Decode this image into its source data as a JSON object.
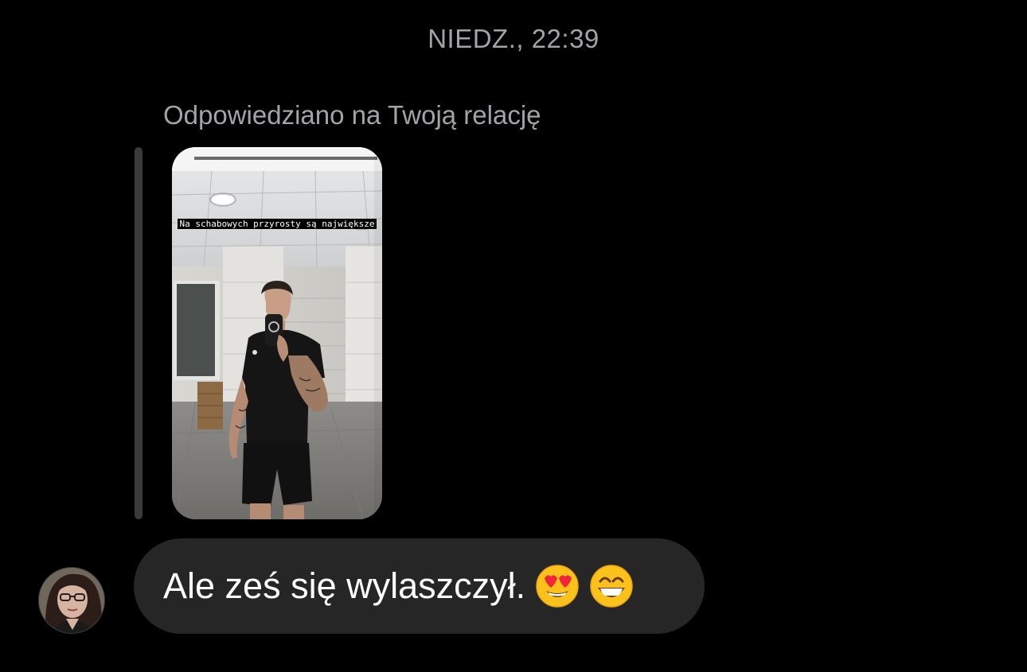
{
  "thread": {
    "timestamp": "NIEDZ., 22:39",
    "reply_caption": "Odpowiedziano na Twoją relację"
  },
  "story": {
    "caption": "Na schabowych przyrosty są największe"
  },
  "message": {
    "text": "Ale ześ się wylaszczył.",
    "emojis": [
      "smiling-face-with-heart-eyes-icon",
      "grinning-face-with-smiling-eyes-icon"
    ]
  },
  "colors": {
    "background": "#000000",
    "bubble": "#262626",
    "secondary_text": "#a3a3a8",
    "reply_bar": "#3a3a3c"
  }
}
